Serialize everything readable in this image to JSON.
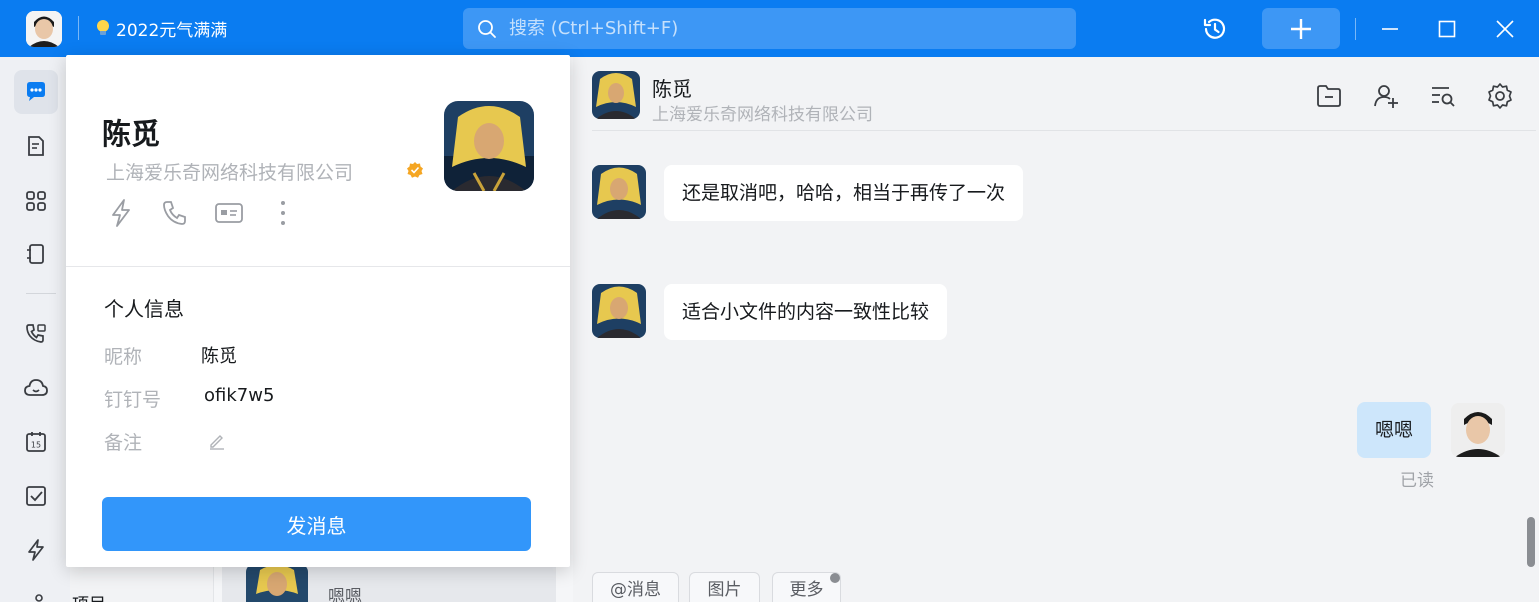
{
  "titlebar": {
    "status_text": "2022元气满满",
    "search_placeholder": "搜索 (Ctrl+Shift+F)",
    "accent": "#0a7cf1"
  },
  "nav": {
    "items": [
      {
        "icon": "chat-icon",
        "active": true
      },
      {
        "icon": "document-icon"
      },
      {
        "icon": "apps-grid-icon"
      },
      {
        "icon": "contacts-book-icon"
      },
      {
        "icon": "phone-call-icon"
      },
      {
        "icon": "cloud-icon"
      },
      {
        "icon": "calendar-icon",
        "badge": "15"
      },
      {
        "icon": "todo-check-icon"
      },
      {
        "icon": "lightning-icon"
      }
    ],
    "partial_label": "项目"
  },
  "profile": {
    "name": "陈觅",
    "company": "上海爱乐奇网络科技有限公司",
    "section_title": "个人信息",
    "fields": [
      {
        "label": "昵称",
        "value": "陈觅"
      },
      {
        "label": "钉钉号",
        "value": "ofik7w5"
      },
      {
        "label": "备注",
        "value": ""
      }
    ],
    "send_button": "发消息"
  },
  "chat": {
    "name": "陈觅",
    "company": "上海爱乐奇网络科技有限公司",
    "messages": [
      {
        "from": "other",
        "text": "还是取消吧，哈哈，相当于再传了一次"
      },
      {
        "from": "other",
        "text": "适合小文件的内容一致性比较"
      },
      {
        "from": "me",
        "text": "嗯嗯",
        "status": "已读"
      }
    ],
    "toolbar": [
      "@消息",
      "图片",
      "更多"
    ]
  },
  "conversation_preview": {
    "text": "嗯嗯"
  }
}
